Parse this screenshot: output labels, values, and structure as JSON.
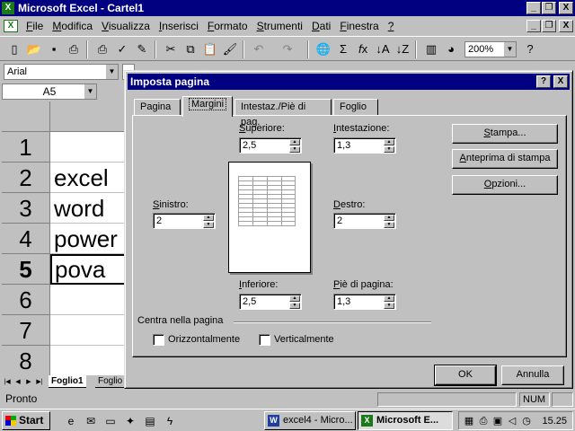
{
  "app": {
    "title": "Microsoft Excel - Cartel1",
    "icon_label": "X",
    "caption_buttons": [
      "_",
      "❐",
      "X"
    ]
  },
  "menu": {
    "items": [
      {
        "u": "F",
        "rest": "ile"
      },
      {
        "u": "M",
        "rest": "odifica"
      },
      {
        "u": "V",
        "rest": "isualizza"
      },
      {
        "u": "I",
        "rest": "nserisci"
      },
      {
        "u": "F",
        "rest": "ormato"
      },
      {
        "u": "S",
        "rest": "trumenti"
      },
      {
        "u": "D",
        "rest": "ati"
      },
      {
        "u": "F",
        "rest": "inestra"
      },
      {
        "u": "?",
        "rest": ""
      }
    ],
    "doc_caption_buttons": [
      "_",
      "❐",
      "X"
    ]
  },
  "toolbar": {
    "zoom": "200%",
    "icons": [
      "new-icon",
      "open-icon",
      "save-icon",
      "print-icon",
      "print-preview-icon",
      "spellcheck-icon",
      "cut-icon",
      "copy-icon",
      "paste-icon",
      "format-painter-icon",
      "undo-icon",
      "redo-icon",
      "hyperlink-icon",
      "autosum-icon",
      "function-icon",
      "sort-asc-icon",
      "sort-desc-icon",
      "chart-wizard-icon",
      "map-icon",
      "help-icon"
    ]
  },
  "format_toolbar": {
    "font": "Arial"
  },
  "name_box": {
    "value": "A5"
  },
  "grid": {
    "rows": [
      {
        "n": "1",
        "a": ""
      },
      {
        "n": "2",
        "a": "excel"
      },
      {
        "n": "3",
        "a": "word"
      },
      {
        "n": "4",
        "a": "power"
      },
      {
        "n": "5",
        "a": "pova"
      },
      {
        "n": "6",
        "a": ""
      },
      {
        "n": "7",
        "a": ""
      },
      {
        "n": "8",
        "a": ""
      }
    ],
    "active_row": "5"
  },
  "sheets": {
    "tabs": [
      "Foglio1",
      "Foglio"
    ]
  },
  "status": {
    "text": "Pronto",
    "num": "NUM"
  },
  "taskbar": {
    "start": "Start",
    "tasks": [
      {
        "label": "excel4 - Micro...",
        "icon": "W",
        "color": "#1f3fa0"
      },
      {
        "label": "Microsoft E...",
        "icon": "X",
        "color": "#1a7a1a"
      }
    ],
    "clock": "15.25"
  },
  "dialog": {
    "title": "Imposta pagina",
    "caption_buttons": [
      "?",
      "X"
    ],
    "tabs": [
      "Pagina",
      "Margini",
      "Intestaz./Piè di pag.",
      "Foglio"
    ],
    "active_tab": "Margini",
    "fields": {
      "superiore": {
        "u": "S",
        "rest": "uperiore:",
        "value": "2,5"
      },
      "intestazione": {
        "u": "I",
        "rest": "ntestazione:",
        "value": "1,3"
      },
      "sinistro": {
        "u": "S",
        "rest": "inistro:",
        "value": "2"
      },
      "destro": {
        "u": "D",
        "rest": "estro:",
        "value": "2"
      },
      "inferiore": {
        "u": "I",
        "rest": "nferiore:",
        "value": "2,5"
      },
      "pie": {
        "u": "P",
        "rest": "iè di pagina:",
        "value": "1,3"
      }
    },
    "buttons": {
      "stampa": {
        "u": "S",
        "rest": "tampa..."
      },
      "anteprima": {
        "u": "A",
        "rest": "nteprima di stampa"
      },
      "opzioni": {
        "u": "O",
        "rest": "pzioni..."
      },
      "ok": "OK",
      "annulla": "Annulla"
    },
    "center_group": {
      "label": "Centra nella pagina",
      "horizontal": {
        "u": "O",
        "rest": "rizzontalmente"
      },
      "vertical": {
        "u": "V",
        "rest": "erticalmente"
      }
    }
  }
}
